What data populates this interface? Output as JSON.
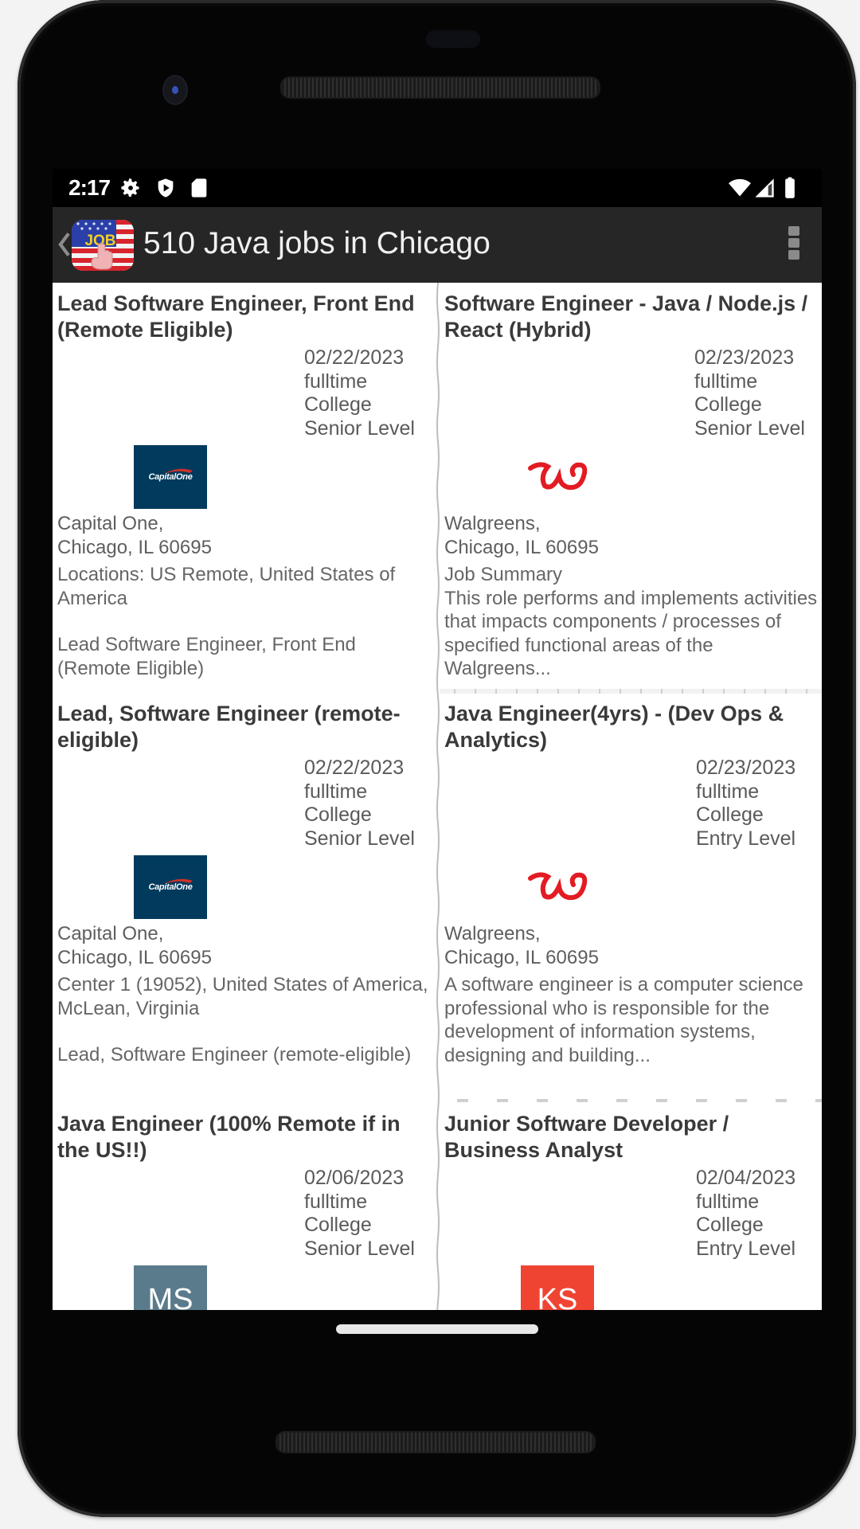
{
  "status_bar": {
    "time": "2:17",
    "left_icons": [
      "gear-icon",
      "shield-play-icon",
      "sd-card-icon"
    ],
    "right_icons": [
      "wifi-icon",
      "cell-signal-icon",
      "battery-icon"
    ]
  },
  "app_bar": {
    "title": "510 Java jobs in Chicago",
    "logo_text": "JOB",
    "back_icon": "chevron-left-icon",
    "menu_icon": "overflow-menu-icon"
  },
  "colors": {
    "app_bar_bg": "#262626",
    "capital_one_blue": "#003a5c",
    "walgreens_red": "#e31b23",
    "ms_tile": "#5a7b8c",
    "ks_tile": "#f04433"
  },
  "jobs": [
    {
      "title": "Lead Software Engineer, Front End (Remote Eligible)",
      "date": "02/22/2023",
      "type": "fulltime",
      "education": "College",
      "level": "Senior Level",
      "logo": "capital-one",
      "logo_text": "CapitalOne",
      "company": "Capital One,",
      "location": "Chicago, IL 60695",
      "description": "Locations: US Remote, United States of America",
      "description2": "Lead Software Engineer, Front End (Remote Eligible)"
    },
    {
      "title": "Software Engineer - Java / Node.js / React (Hybrid)",
      "date": "02/23/2023",
      "type": "fulltime",
      "education": "College",
      "level": "Senior Level",
      "logo": "walgreens",
      "logo_text": "W",
      "company": "Walgreens,",
      "location": "Chicago, IL 60695",
      "description": "Job Summary\nThis role performs and implements activities that impacts components / processes of specified functional areas of the Walgreens...",
      "description2": ""
    },
    {
      "title": "Lead, Software Engineer (remote-eligible)",
      "date": "02/22/2023",
      "type": "fulltime",
      "education": "College",
      "level": "Senior Level",
      "logo": "capital-one",
      "logo_text": "CapitalOne",
      "company": "Capital One,",
      "location": "Chicago, IL 60695",
      "description": "Center 1 (19052), United States of America, McLean, Virginia",
      "description2": "Lead, Software Engineer (remote-eligible)"
    },
    {
      "title": "Java Engineer(4yrs) - (Dev Ops & Analytics)",
      "date": "02/23/2023",
      "type": "fulltime",
      "education": "College",
      "level": "Entry Level",
      "logo": "walgreens",
      "logo_text": "W",
      "company": "Walgreens,",
      "location": "Chicago, IL 60695",
      "description": "A software engineer is a computer science professional who is responsible for the development of information systems, designing and building...",
      "description2": ""
    },
    {
      "title": "Java Engineer (100% Remote if in the US!!)",
      "date": "02/06/2023",
      "type": "fulltime",
      "education": "College",
      "level": "Senior Level",
      "logo": "initials",
      "logo_text": "MS"
    },
    {
      "title": "Junior Software Developer / Business Analyst",
      "date": "02/04/2023",
      "type": "fulltime",
      "education": "College",
      "level": "Entry Level",
      "logo": "initials",
      "logo_text": "KS"
    }
  ]
}
